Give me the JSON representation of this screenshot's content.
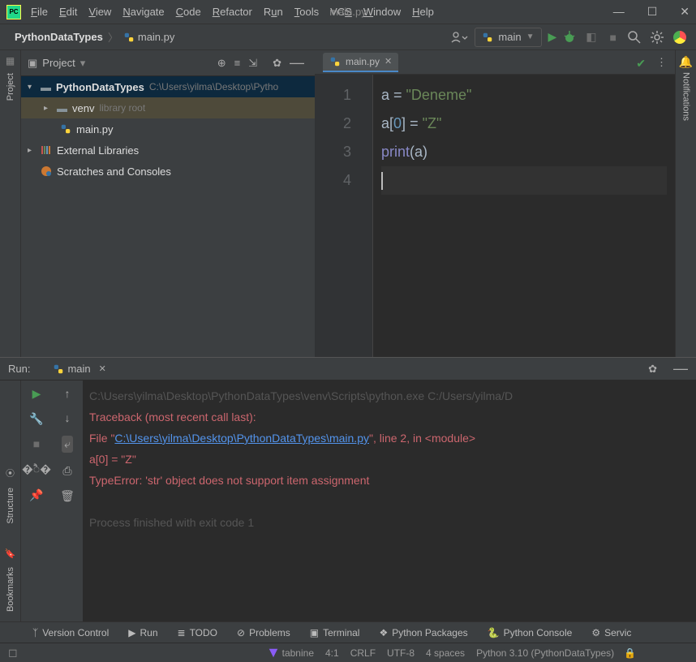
{
  "title": "main.py",
  "menus": [
    "File",
    "Edit",
    "View",
    "Navigate",
    "Code",
    "Refactor",
    "Run",
    "Tools",
    "VCS",
    "Window",
    "Help"
  ],
  "breadcrumb": {
    "project": "PythonDataTypes",
    "file": "main.py"
  },
  "runConfig": "main",
  "project": {
    "panelTitle": "Project",
    "root": {
      "name": "PythonDataTypes",
      "path": "C:\\Users\\yilma\\Desktop\\Pytho"
    },
    "venv": {
      "name": "venv",
      "note": "library root"
    },
    "file": "main.py",
    "ext": "External Libraries",
    "scratch": "Scratches and Consoles"
  },
  "editorTab": "main.py",
  "code": {
    "l1a": "a ",
    "l1b": "= ",
    "l1c": "\"Deneme\"",
    "l2a": "a",
    "l2b": "[",
    "l2c": "0",
    "l2d": "] ",
    "l2e": "= ",
    "l2f": "\"Z\"",
    "l3a": "print",
    "l3b": "(",
    "l3c": "a",
    "l3d": ")"
  },
  "gutter": [
    "1",
    "2",
    "3",
    "4"
  ],
  "run": {
    "label": "Run:",
    "cfg": "main",
    "cmd": "C:\\Users\\yilma\\Desktop\\PythonDataTypes\\venv\\Scripts\\python.exe C:/Users/yilma/D",
    "trace": "Traceback (most recent call last):",
    "file_pre": "  File \"",
    "file_link": "C:\\Users\\yilma\\Desktop\\PythonDataTypes\\main.py",
    "file_post": "\", line 2, in <module>",
    "codeline": "    a[0] = \"Z\"",
    "err": "TypeError: 'str' object does not support item assignment",
    "exit": "Process finished with exit code 1"
  },
  "bottom1": {
    "vc": "Version Control",
    "run": "Run",
    "todo": "TODO",
    "prob": "Problems",
    "term": "Terminal",
    "pkg": "Python Packages",
    "pycon": "Python Console",
    "svc": "Servic"
  },
  "bottom2": {
    "tabnine": "tabnine",
    "pos": "4:1",
    "eol": "CRLF",
    "enc": "UTF-8",
    "indent": "4 spaces",
    "interp": "Python 3.10 (PythonDataTypes)"
  },
  "side": {
    "project": "Project",
    "structure": "Structure",
    "bookmarks": "Bookmarks",
    "notif": "Notifications"
  }
}
